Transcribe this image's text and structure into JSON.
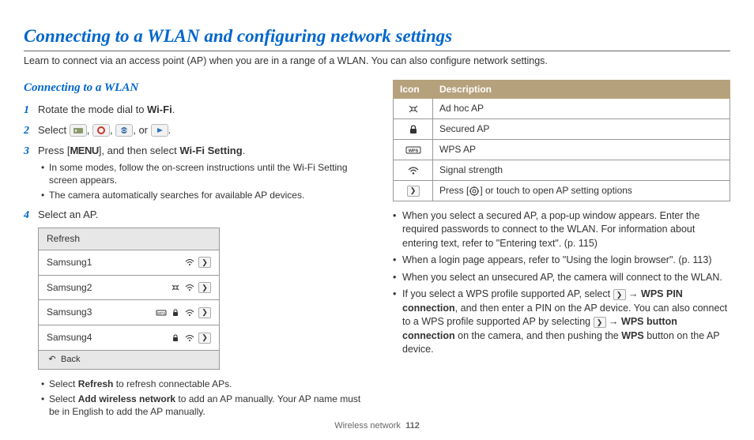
{
  "title": "Connecting to a WLAN and configuring network settings",
  "intro": "Learn to connect via an access point (AP) when you are in a range of a WLAN. You can also configure network settings.",
  "section_heading": "Connecting to a WLAN",
  "steps": {
    "s1": {
      "num": "1",
      "text_a": "Rotate the mode dial to ",
      "wifi": "Wi-Fi",
      "text_b": "."
    },
    "s2": {
      "num": "2",
      "text_a": "Select ",
      "text_b": ", ",
      "text_c": ", ",
      "text_d": ", or ",
      "text_e": "."
    },
    "s3": {
      "num": "3",
      "text_a": "Press [",
      "menu": "MENU",
      "text_b": "], and then select ",
      "bold": "Wi-Fi Setting",
      "text_c": ".",
      "sub1": "In some modes, follow the on-screen instructions until the Wi-Fi Setting screen appears.",
      "sub2": "The camera automatically searches for available AP devices."
    },
    "s4": {
      "num": "4",
      "text": "Select an AP."
    }
  },
  "ap_list": {
    "refresh": "Refresh",
    "items": [
      "Samsung1",
      "Samsung2",
      "Samsung3",
      "Samsung4"
    ],
    "back": "Back"
  },
  "post_sub": {
    "a_pre": "Select ",
    "a_bold": "Refresh",
    "a_post": " to refresh connectable APs.",
    "b_pre": "Select ",
    "b_bold": "Add wireless network",
    "b_post": " to add an AP manually. Your AP name must be in English to add the AP manually."
  },
  "table": {
    "h1": "Icon",
    "h2": "Description",
    "r1": "Ad hoc AP",
    "r2": "Secured AP",
    "r3": "WPS AP",
    "r4": "Signal strength",
    "r5_a": "Press [",
    "r5_b": "] or touch to open AP setting options"
  },
  "bullets": {
    "b1": "When you select a secured AP, a pop-up window appears. Enter the required passwords to connect to the WLAN. For information about entering text, refer to \"Entering text\". (p. 115)",
    "b2": "When a login page appears, refer to \"Using the login browser\". (p. 113)",
    "b3": "When you select an unsecured AP, the camera will connect to the WLAN.",
    "b4_a": "If you select a WPS profile supported AP, select ",
    "b4_b": " → ",
    "b4_bold1": "WPS PIN connection",
    "b4_c": ", and then enter a PIN on the AP device. You can also connect to a WPS profile supported AP by selecting ",
    "b4_d": " → ",
    "b4_bold2": "WPS button connection",
    "b4_e": " on the camera, and then pushing the ",
    "b4_bold3": "WPS",
    "b4_f": " button on the AP device."
  },
  "footer": {
    "section": "Wireless network",
    "page": "112"
  }
}
